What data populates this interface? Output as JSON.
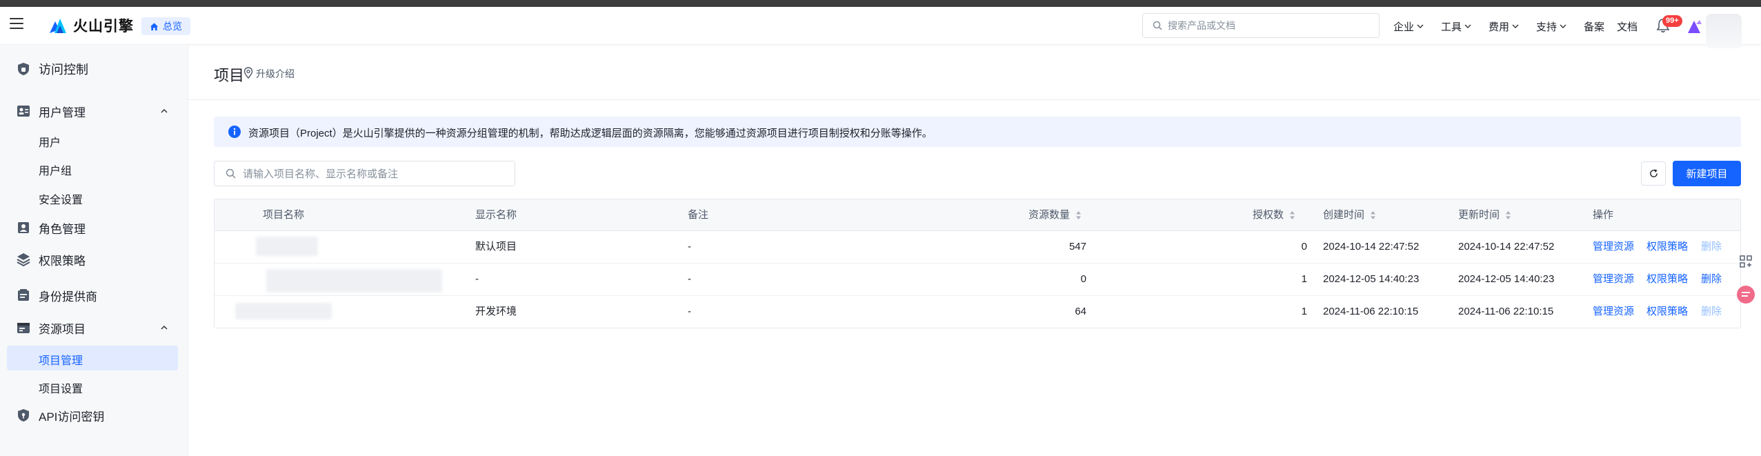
{
  "header": {
    "logo_text": "火山引擎",
    "home_label": "总览",
    "search_placeholder": "搜索产品或文档",
    "nav": [
      {
        "label": "企业",
        "has_dropdown": true
      },
      {
        "label": "工具",
        "has_dropdown": true
      },
      {
        "label": "费用",
        "has_dropdown": true
      },
      {
        "label": "支持",
        "has_dropdown": true
      },
      {
        "label": "备案",
        "has_dropdown": false
      },
      {
        "label": "文档",
        "has_dropdown": false
      }
    ],
    "notification_badge": "99+"
  },
  "sidebar": {
    "items": [
      {
        "label": "访问控制",
        "icon": "access-control-icon"
      },
      {
        "label": "用户管理",
        "icon": "user-management-icon",
        "expanded": true,
        "children": [
          "用户",
          "用户组",
          "安全设置"
        ]
      },
      {
        "label": "角色管理",
        "icon": "role-icon"
      },
      {
        "label": "权限策略",
        "icon": "policy-layers-icon"
      },
      {
        "label": "身份提供商",
        "icon": "identity-provider-icon"
      },
      {
        "label": "资源项目",
        "icon": "resource-project-icon",
        "expanded": true,
        "children": [
          "项目管理",
          "项目设置"
        ]
      },
      {
        "label": "API访问密钥",
        "icon": "api-key-icon"
      }
    ],
    "active_item": "项目管理"
  },
  "main": {
    "title": "项目",
    "upgrade_label": "升级介绍",
    "info_text": "资源项目（Project）是火山引擎提供的一种资源分组管理的机制，帮助达成逻辑层面的资源隔离，您能够通过资源项目进行项目制授权和分账等操作。",
    "filter_placeholder": "请输入项目名称、显示名称或备注",
    "new_button": "新建项目",
    "table": {
      "columns": [
        "项目名称",
        "显示名称",
        "备注",
        "资源数量",
        "授权数",
        "创建时间",
        "更新时间",
        "操作"
      ],
      "rows": [
        {
          "name": "",
          "display": "默认项目",
          "note": "-",
          "resources": "547",
          "grants": "0",
          "created": "2024-10-14 22:47:52",
          "updated": "2024-10-14 22:47:52",
          "ops": [
            "管理资源",
            "权限策略",
            "删除"
          ],
          "delete_enabled": false
        },
        {
          "name": "",
          "display": "-",
          "note": "-",
          "resources": "0",
          "grants": "1",
          "created": "2024-12-05 14:40:23",
          "updated": "2024-12-05 14:40:23",
          "ops": [
            "管理资源",
            "权限策略",
            "删除"
          ],
          "delete_enabled": true
        },
        {
          "name": "",
          "display": "开发环境",
          "note": "-",
          "resources": "64",
          "grants": "1",
          "created": "2024-11-06 22:10:15",
          "updated": "2024-11-06 22:10:15",
          "ops": [
            "管理资源",
            "权限策略",
            "删除"
          ],
          "delete_enabled": false
        }
      ]
    }
  },
  "colors": {
    "primary": "#1664ff",
    "disabled_link": "#94bfff",
    "info_bg": "#eef3ff",
    "sidebar_bg": "#f7f8fa",
    "active_bg": "#e1eaff",
    "badge": "#f53f3f"
  }
}
